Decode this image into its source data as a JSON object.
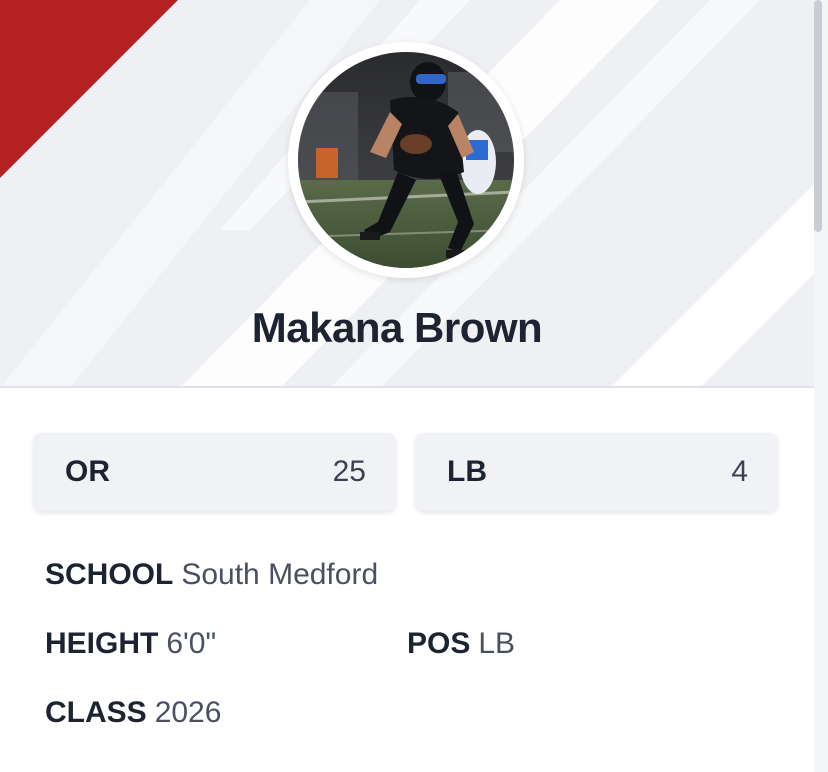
{
  "player": {
    "name": "Makana Brown"
  },
  "rankings": {
    "state": {
      "label": "OR",
      "value": "25"
    },
    "position": {
      "label": "LB",
      "value": "4"
    }
  },
  "details": {
    "school": {
      "label": "SCHOOL",
      "value": "South Medford"
    },
    "height": {
      "label": "HEIGHT",
      "value": "6'0\""
    },
    "pos": {
      "label": "POS",
      "value": "LB"
    },
    "class": {
      "label": "CLASS",
      "value": "2026"
    }
  },
  "colors": {
    "accent": "#b42121",
    "text": "#1d2330",
    "card_bg": "#f1f2f5"
  },
  "icons": {
    "avatar": "player-photo"
  }
}
